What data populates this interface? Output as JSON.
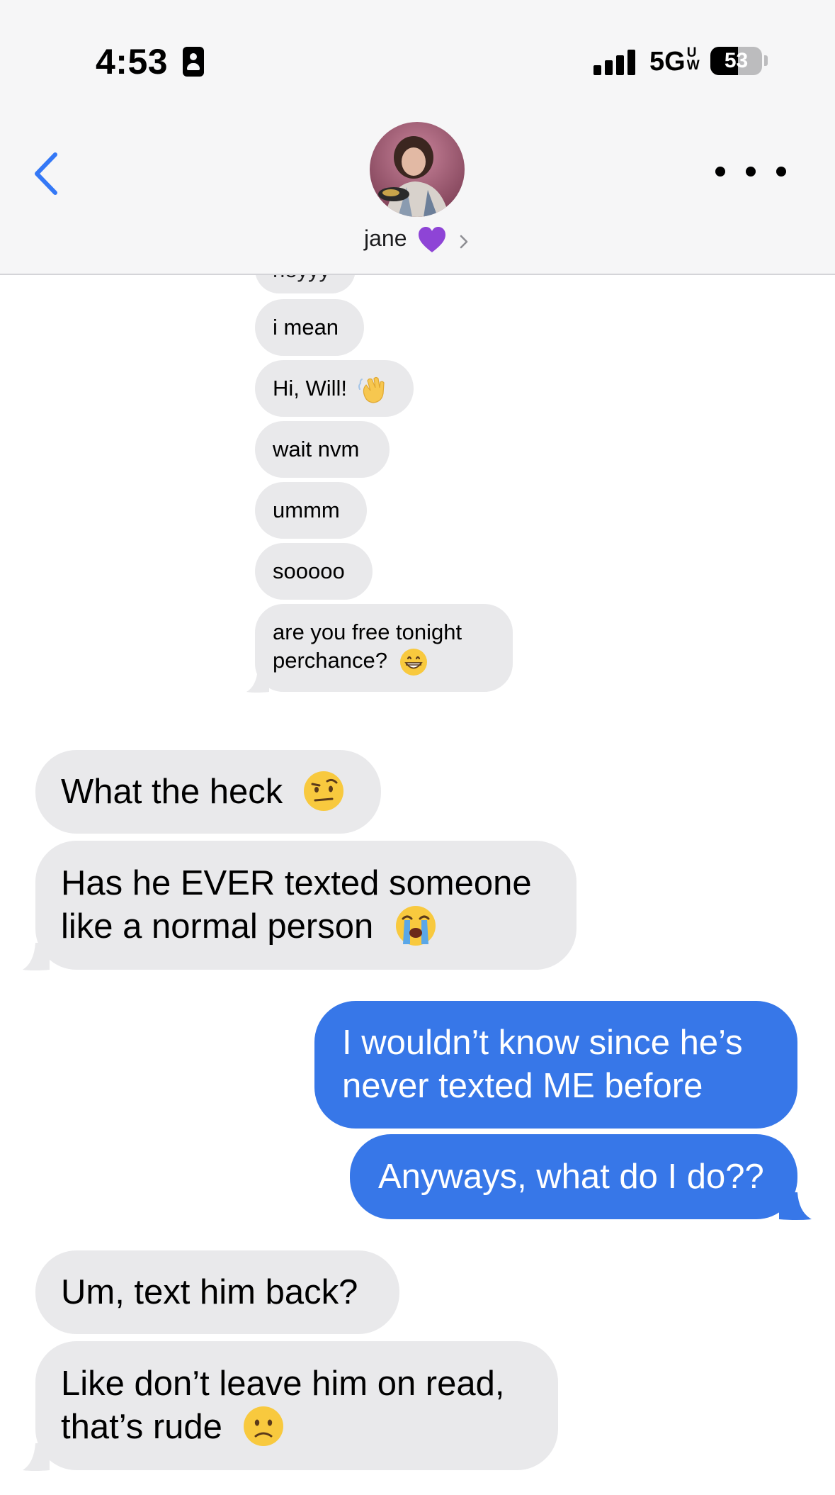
{
  "status_bar": {
    "time": "4:53",
    "network": "5G",
    "network_sub": "UW",
    "battery": "53",
    "battery_level": 0.53
  },
  "header": {
    "contact_name": "jane",
    "heart_emoji_color": "#8e44d6",
    "back_icon": "chevron-left-icon",
    "more_icon": "ellipsis-icon"
  },
  "quoted_thread": [
    "heyyy",
    "i mean",
    "Hi, Will!",
    "wait nvm",
    "ummm",
    "sooooo",
    "are you free tonight",
    "perchance?"
  ],
  "messages": {
    "recv_1": "What the heck",
    "recv_2_line1": "Has he EVER texted someone",
    "recv_2_line2": "like a normal person",
    "sent_1_line1": "I wouldn’t know since he’s",
    "sent_1_line2": "never texted ME before",
    "sent_2": "Anyways, what do I do??",
    "recv_3": "Um, text him back?",
    "recv_4_line1": "Like don’t leave him on read,",
    "recv_4_line2": "that’s rude"
  },
  "colors": {
    "sent_bubble": "#3777e8",
    "received_bubble": "#e9e9eb",
    "accent": "#3478f6"
  }
}
